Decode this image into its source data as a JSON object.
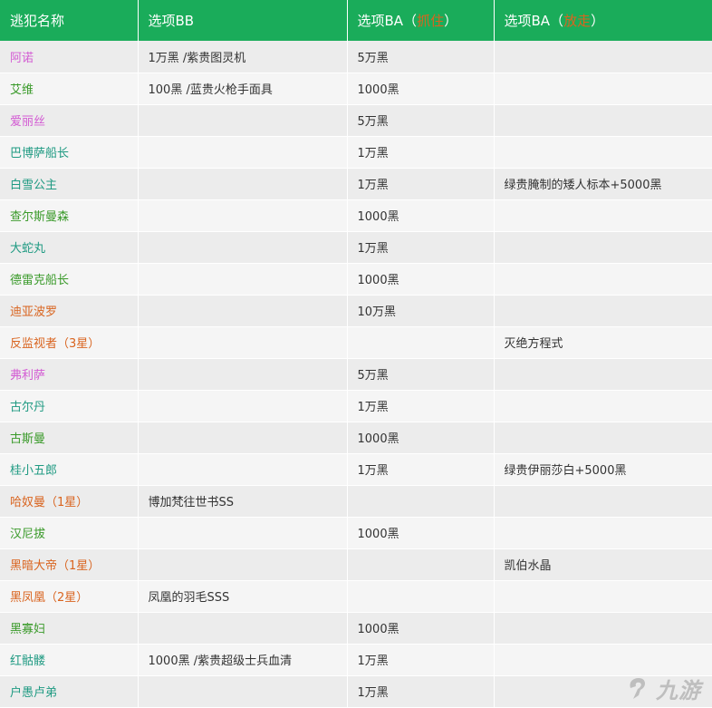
{
  "table": {
    "headers": [
      {
        "text": "逃犯名称",
        "highlight": ""
      },
      {
        "text": "选项BB",
        "highlight": ""
      },
      {
        "text": "选项BA（",
        "highlight": "抓住",
        "suffix": "）"
      },
      {
        "text": "选项BA（",
        "highlight": "放走",
        "suffix": "）"
      }
    ],
    "highlight_color": "#d9641f",
    "header_color": "#1aac5a",
    "rows": [
      {
        "name": "阿诺",
        "color": "#d35bd3",
        "bb": "1万黑 /紫贵图灵机",
        "catch": "5万黑",
        "release": ""
      },
      {
        "name": "艾维",
        "color": "#3a9a2a",
        "bb": "100黑 /蓝贵火枪手面具",
        "catch": "1000黑",
        "release": ""
      },
      {
        "name": "爱丽丝",
        "color": "#d35bd3",
        "bb": "",
        "catch": "5万黑",
        "release": ""
      },
      {
        "name": "巴博萨船长",
        "color": "#1f9a82",
        "bb": "",
        "catch": "1万黑",
        "release": ""
      },
      {
        "name": "白雪公主",
        "color": "#1f9a82",
        "bb": "",
        "catch": "1万黑",
        "release": "绿贵腌制的矮人标本+5000黑"
      },
      {
        "name": "查尔斯曼森",
        "color": "#3a9a2a",
        "bb": "",
        "catch": "1000黑",
        "release": ""
      },
      {
        "name": "大蛇丸",
        "color": "#1f9a82",
        "bb": "",
        "catch": "1万黑",
        "release": ""
      },
      {
        "name": "德雷克船长",
        "color": "#3a9a2a",
        "bb": "",
        "catch": "1000黑",
        "release": ""
      },
      {
        "name": "迪亚波罗",
        "color": "#d9641f",
        "bb": "",
        "catch": "10万黑",
        "release": ""
      },
      {
        "name": "反监视者（3星）",
        "color": "#d9641f",
        "bb": "",
        "catch": "",
        "release": "灭绝方程式"
      },
      {
        "name": "弗利萨",
        "color": "#d35bd3",
        "bb": "",
        "catch": "5万黑",
        "release": ""
      },
      {
        "name": "古尔丹",
        "color": "#1f9a82",
        "bb": "",
        "catch": "1万黑",
        "release": ""
      },
      {
        "name": "古斯曼",
        "color": "#3a9a2a",
        "bb": "",
        "catch": "1000黑",
        "release": ""
      },
      {
        "name": "桂小五郎",
        "color": "#1f9a82",
        "bb": "",
        "catch": "1万黑",
        "release": "绿贵伊丽莎白+5000黑"
      },
      {
        "name": "哈奴曼（1星）",
        "color": "#d9641f",
        "bb": "博加梵往世书SS",
        "catch": "",
        "release": ""
      },
      {
        "name": "汉尼拔",
        "color": "#3a9a2a",
        "bb": "",
        "catch": "1000黑",
        "release": ""
      },
      {
        "name": "黑暗大帝（1星）",
        "color": "#d9641f",
        "bb": "",
        "catch": "",
        "release": "凯伯水晶"
      },
      {
        "name": "黑凤凰（2星）",
        "color": "#d9641f",
        "bb": "凤凰的羽毛SSS",
        "catch": "",
        "release": ""
      },
      {
        "name": "黑寡妇",
        "color": "#3a9a2a",
        "bb": "",
        "catch": "1000黑",
        "release": ""
      },
      {
        "name": "红骷髅",
        "color": "#1f9a82",
        "bb": "1000黑 /紫贵超级士兵血清",
        "catch": "1万黑",
        "release": ""
      },
      {
        "name": "户愚卢弟",
        "color": "#1f9a82",
        "bb": "",
        "catch": "1万黑",
        "release": ""
      }
    ]
  },
  "watermark": {
    "text": "九游",
    "icon": "jiuyou-logo-icon"
  }
}
